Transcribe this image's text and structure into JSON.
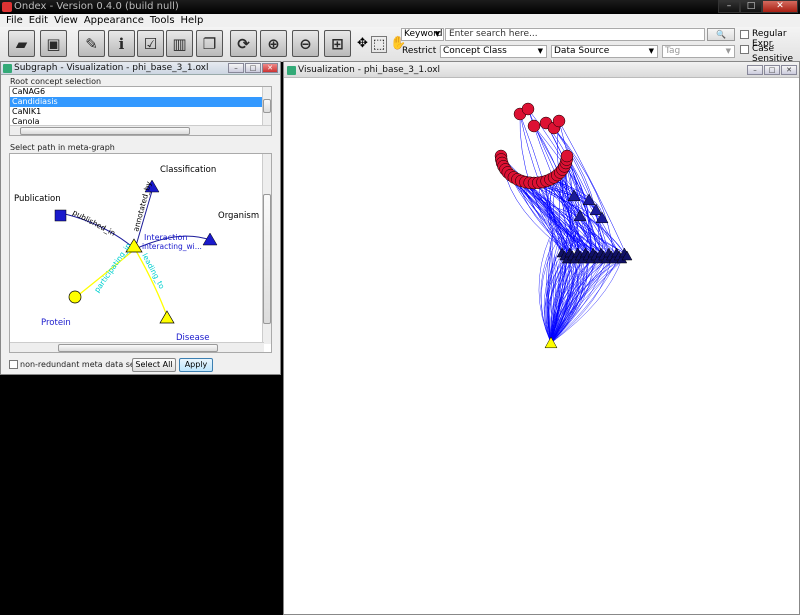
{
  "window": {
    "title": "Ondex - Version 0.4.0 (build null)"
  },
  "menu": [
    "File",
    "Edit",
    "View",
    "Appearance",
    "Tools",
    "Help"
  ],
  "search": {
    "mode": "Keyword",
    "placeholder": "Enter search here...",
    "restrict_label": "Restrict by:",
    "concept_class": "Concept Class",
    "data_source": "Data Source",
    "tag": "Tag",
    "regex_label": "Regular Expr.",
    "case_label": "Case Sensitive"
  },
  "subgraph": {
    "title": "Subgraph - Visualization - phi_base_3_1.oxl",
    "root_label": "Root concept selection",
    "items": [
      "CaNAG6",
      "Candidiasis",
      "CaNIK1",
      "Canola"
    ],
    "selected_index": 1,
    "path_label": "Select path in meta-graph",
    "nonredundant_label": "non-redundant meta data selection?",
    "select_all": "Select All",
    "apply": "Apply"
  },
  "metagraph": {
    "nodes": {
      "classification": "Classification",
      "publication": "Publication",
      "organism": "Organism",
      "interaction": "Interaction",
      "protein": "Protein",
      "disease": "Disease"
    },
    "edges": {
      "annotated": "annotated_by",
      "published": "published_in",
      "interacting": "interacting_wi...",
      "participating": "participating_in",
      "leading": "leading_to"
    }
  },
  "visualization": {
    "title": "Visualization - phi_base_3_1.oxl"
  },
  "colors": {
    "edge": "#0000ff",
    "interaction": "#ffff00",
    "disease_circle": "#dd1133",
    "class_triangle": "#1a1a99",
    "selected": "#3399ff"
  }
}
